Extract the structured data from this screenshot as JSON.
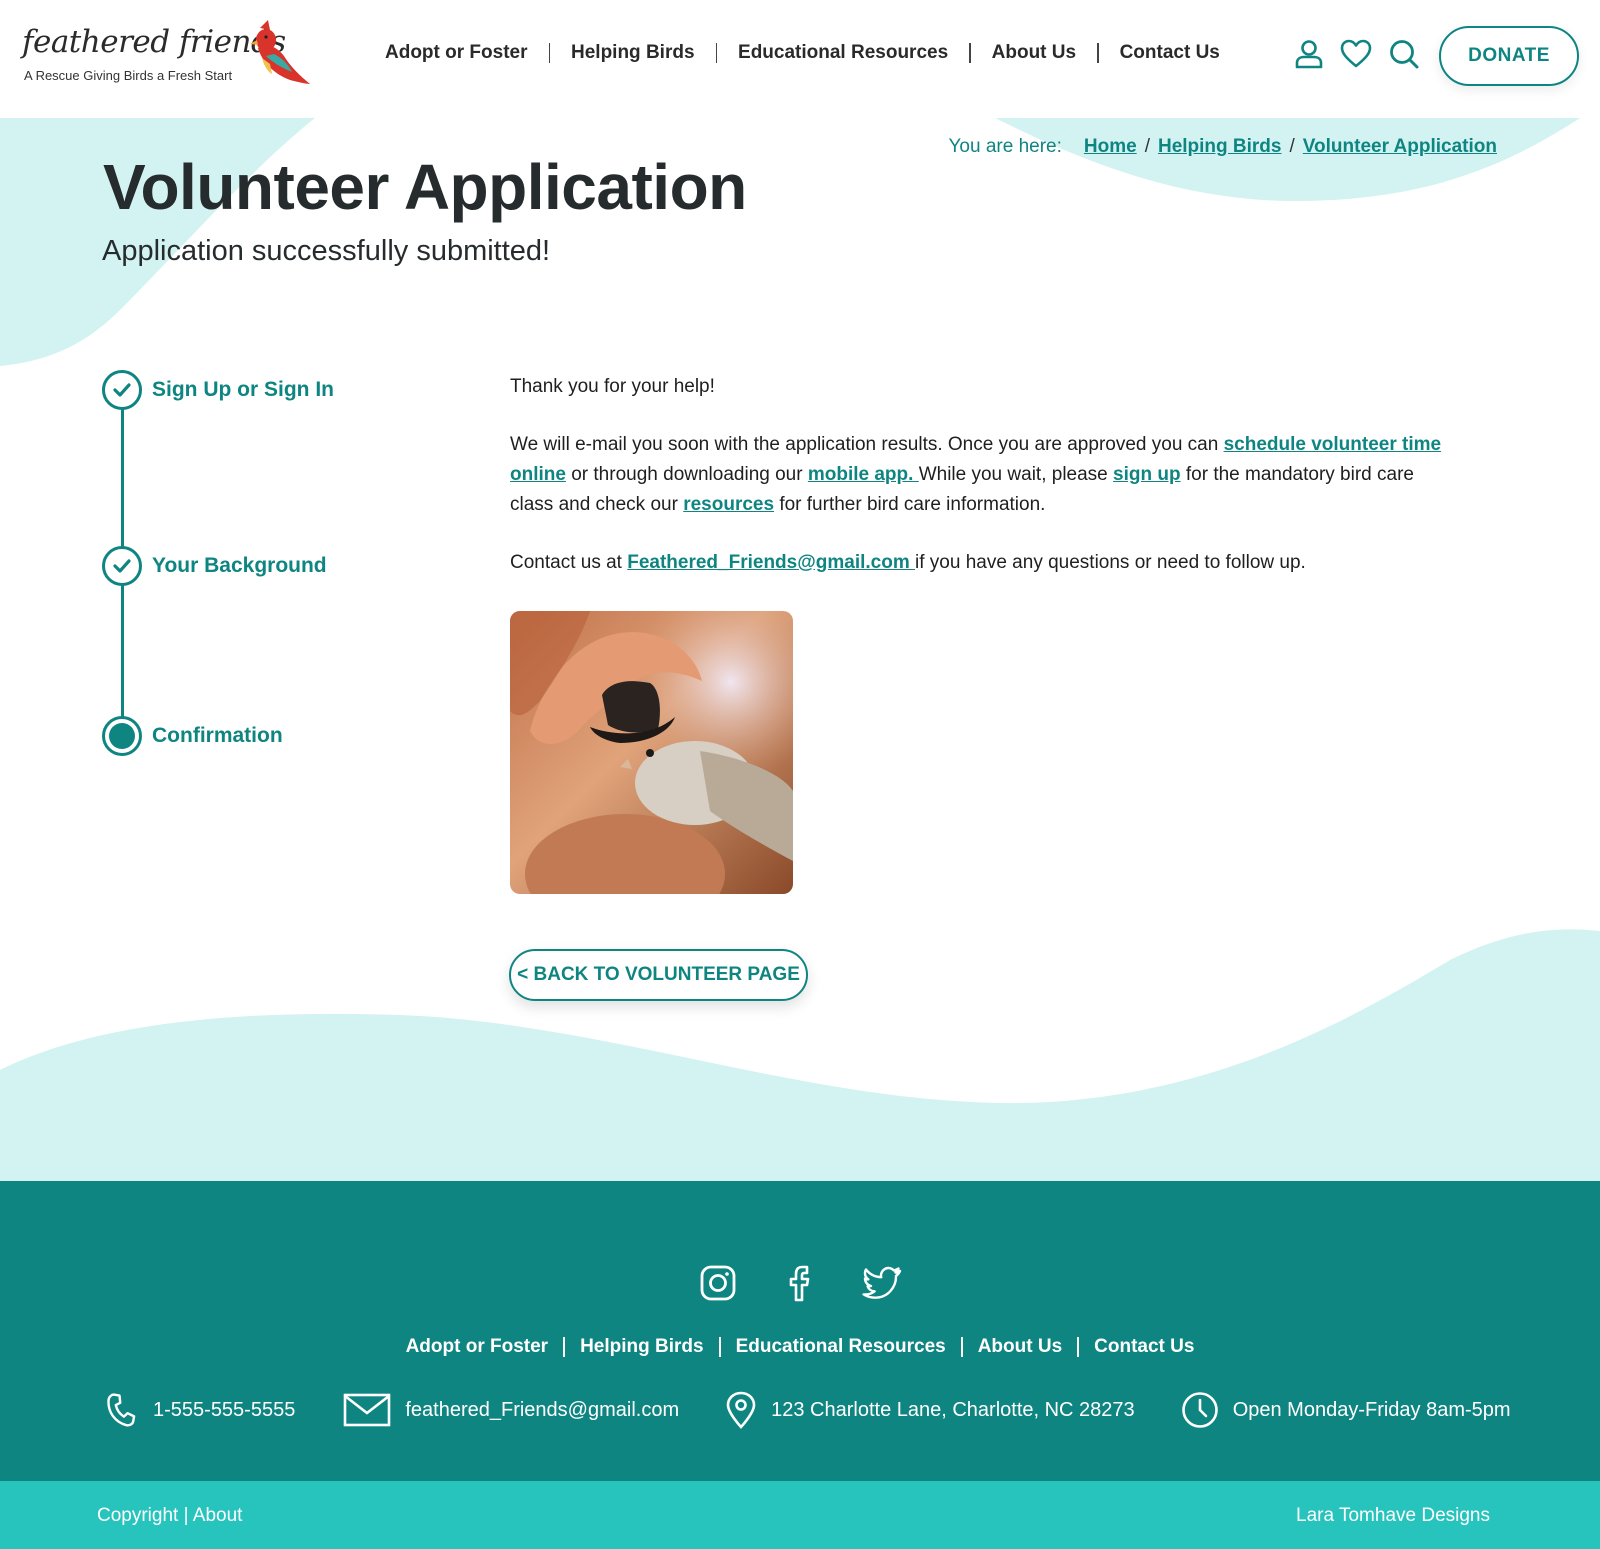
{
  "brand": {
    "name": "feathered friends",
    "tagline": "A Rescue Giving Birds a Fresh Start"
  },
  "header": {
    "nav": [
      "Adopt or Foster",
      "Helping Birds",
      "Educational Resources",
      "About Us",
      "Contact Us"
    ],
    "icons": [
      "user-icon",
      "heart-icon",
      "search-icon"
    ],
    "donate_label": "DONATE"
  },
  "breadcrumb": {
    "label": "You are here:",
    "items": [
      "Home",
      "Helping Birds",
      "Volunteer Application"
    ]
  },
  "page": {
    "title": "Volunteer Application",
    "subtitle": "Application successfully submitted!"
  },
  "steps": [
    {
      "label": "Sign Up or Sign In",
      "state": "complete"
    },
    {
      "label": "Your Background",
      "state": "complete"
    },
    {
      "label": "Confirmation",
      "state": "current"
    }
  ],
  "content": {
    "thanks": "Thank you for your help!",
    "p2_a": "We will e-mail you soon with the application results. Once you are approved you can ",
    "p2_link1": "schedule volunteer time online",
    "p2_b": " or through downloading our ",
    "p2_link2": "mobile app. ",
    "p2_c": " While you wait, please ",
    "p2_link3": "sign up",
    "p2_d": " for the mandatory bird care class and check our ",
    "p2_link4": "resources",
    "p2_e": " for further bird care information.",
    "p3_a": "Contact us at ",
    "p3_link": "Feathered_Friends@gmail.com ",
    "p3_b": "if you have any questions or need to follow up."
  },
  "back_button": "< BACK TO VOLUNTEER PAGE",
  "footer": {
    "social": [
      "instagram-icon",
      "facebook-icon",
      "twitter-icon"
    ],
    "nav": [
      "Adopt or Foster",
      "Helping Birds",
      "Educational Resources",
      "About Us",
      "Contact Us"
    ],
    "phone": "1-555-555-5555",
    "email": "feathered_Friends@gmail.com",
    "address": "123 Charlotte Lane, Charlotte, NC 28273",
    "hours": "Open Monday-Friday 8am-5pm",
    "copyright": "Copyright",
    "about": "About",
    "credit": "Lara Tomhave Designs"
  },
  "colors": {
    "teal": "#0f8582",
    "light_teal": "#d2f3f1",
    "bar_teal": "#27c4bd"
  }
}
